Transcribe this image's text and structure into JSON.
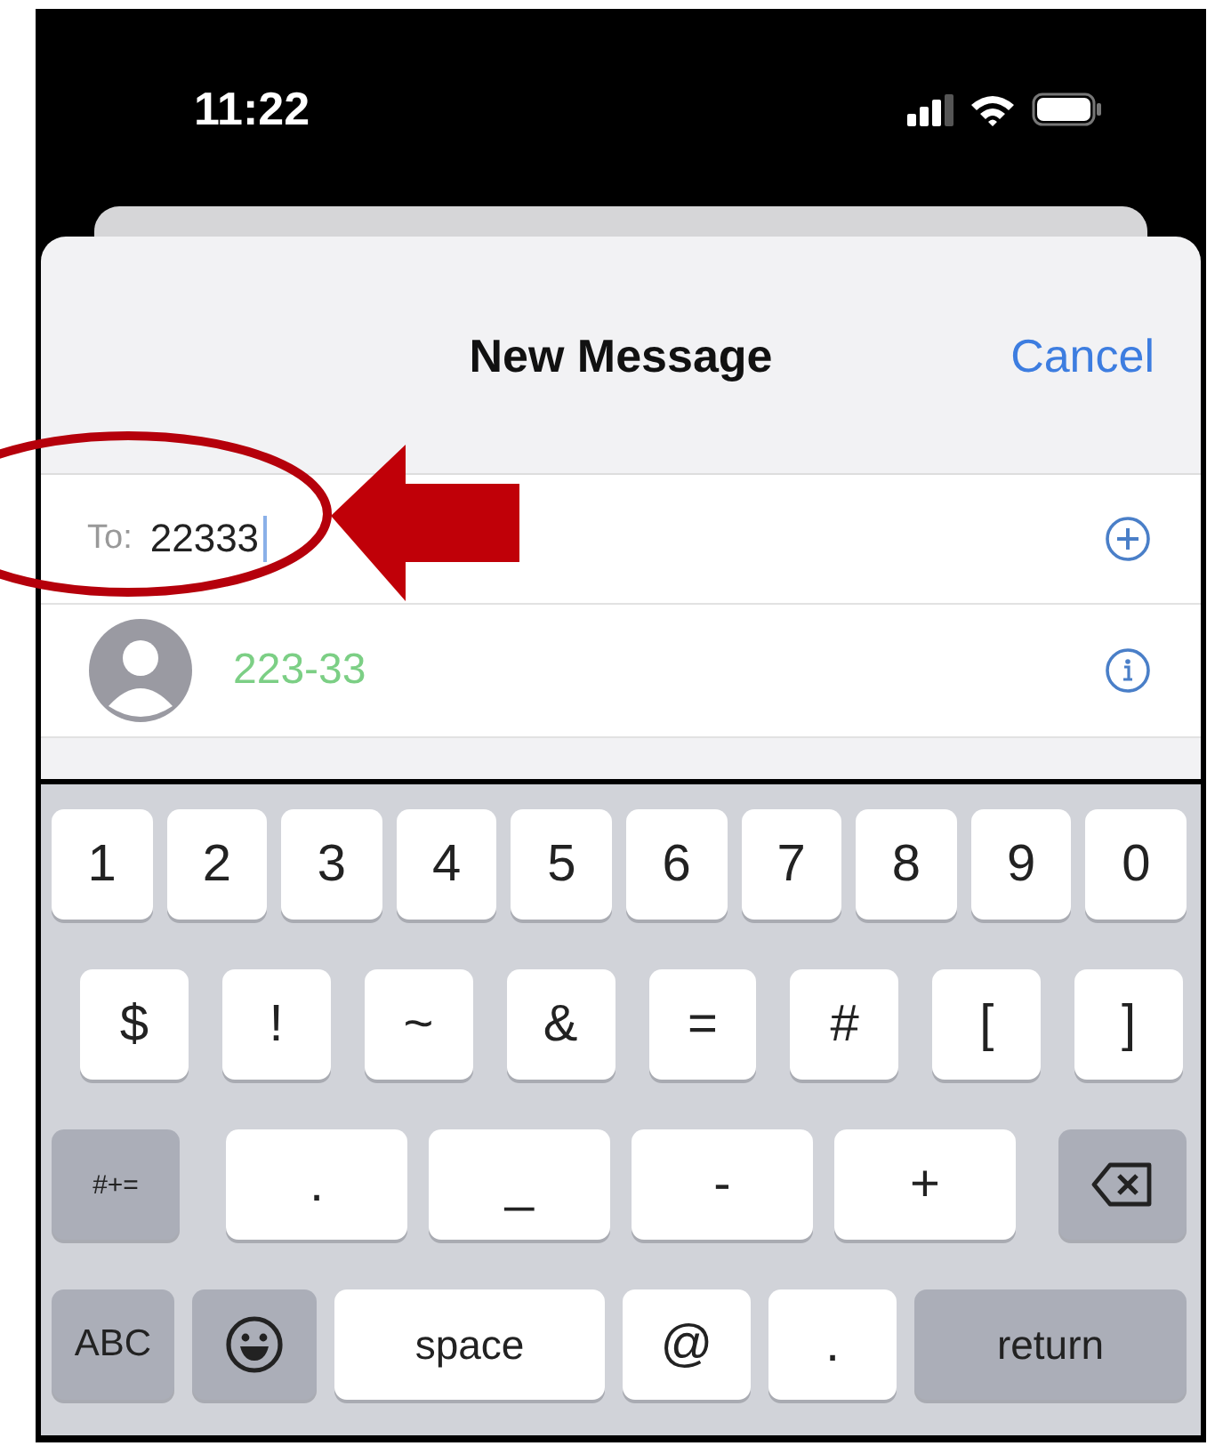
{
  "status_bar": {
    "time": "11:22"
  },
  "header": {
    "title": "New Message",
    "cancel": "Cancel"
  },
  "recipient": {
    "label": "To:",
    "value": "22333"
  },
  "suggestions": [
    {
      "number": "223-33"
    }
  ],
  "keyboard": {
    "rows": [
      {
        "keys": [
          {
            "kind": "char",
            "label": "1"
          },
          {
            "kind": "char",
            "label": "2"
          },
          {
            "kind": "char",
            "label": "3"
          },
          {
            "kind": "char",
            "label": "4"
          },
          {
            "kind": "char",
            "label": "5"
          },
          {
            "kind": "char",
            "label": "6"
          },
          {
            "kind": "char",
            "label": "7"
          },
          {
            "kind": "char",
            "label": "8"
          },
          {
            "kind": "char",
            "label": "9"
          },
          {
            "kind": "char",
            "label": "0"
          }
        ]
      },
      {
        "keys": [
          {
            "kind": "char",
            "label": "$"
          },
          {
            "kind": "char",
            "label": "!"
          },
          {
            "kind": "char",
            "label": "~"
          },
          {
            "kind": "char",
            "label": "&"
          },
          {
            "kind": "char",
            "label": "="
          },
          {
            "kind": "char",
            "label": "#"
          },
          {
            "kind": "char",
            "label": "["
          },
          {
            "kind": "char",
            "label": "]"
          }
        ]
      },
      {
        "keys": [
          {
            "kind": "function",
            "label": "#+="
          },
          {
            "kind": "char",
            "label": "."
          },
          {
            "kind": "char",
            "label": "_"
          },
          {
            "kind": "char",
            "label": "-"
          },
          {
            "kind": "char",
            "label": "+"
          },
          {
            "kind": "delete"
          }
        ]
      },
      {
        "keys": [
          {
            "kind": "function",
            "label": "ABC"
          },
          {
            "kind": "emoji"
          },
          {
            "kind": "space",
            "label": "space"
          },
          {
            "kind": "char",
            "label": "@"
          },
          {
            "kind": "char",
            "label": "."
          },
          {
            "kind": "return",
            "label": "return"
          }
        ]
      }
    ]
  }
}
